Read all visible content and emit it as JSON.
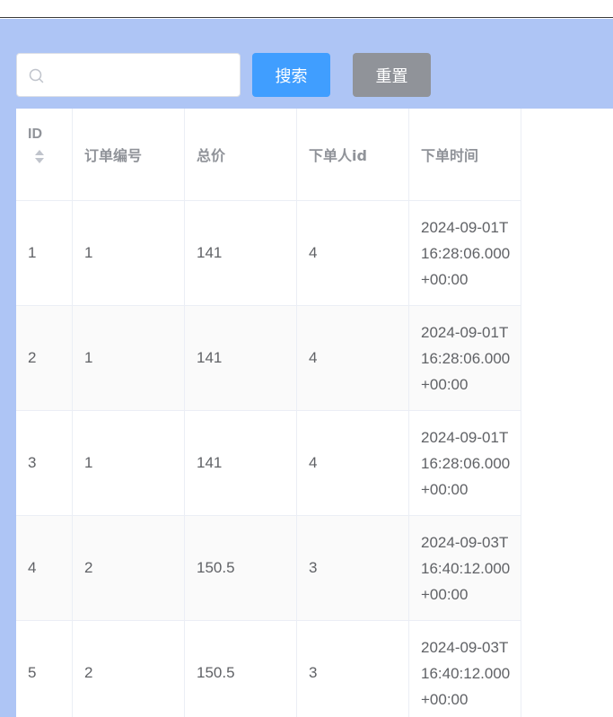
{
  "search": {
    "placeholder": "",
    "value": "",
    "search_label": "搜索",
    "reset_label": "重置"
  },
  "table": {
    "columns": [
      "ID",
      "订单编号",
      "总价",
      "下单人id",
      "下单时间"
    ],
    "rows": [
      {
        "id": "1",
        "order_no": "1",
        "total": "141",
        "user_id": "4",
        "time": "2024-09-01T16:28:06.000+00:00"
      },
      {
        "id": "2",
        "order_no": "1",
        "total": "141",
        "user_id": "4",
        "time": "2024-09-01T16:28:06.000+00:00"
      },
      {
        "id": "3",
        "order_no": "1",
        "total": "141",
        "user_id": "4",
        "time": "2024-09-01T16:28:06.000+00:00"
      },
      {
        "id": "4",
        "order_no": "2",
        "total": "150.5",
        "user_id": "3",
        "time": "2024-09-03T16:40:12.000+00:00"
      },
      {
        "id": "5",
        "order_no": "2",
        "total": "150.5",
        "user_id": "3",
        "time": "2024-09-03T16:40:12.000+00:00"
      }
    ]
  },
  "colors": {
    "background": "#aec5f5",
    "search_button": "#409eff",
    "reset_button": "#909399"
  },
  "icons": {
    "search": "search-icon",
    "sort": "sort-caret-icon"
  }
}
